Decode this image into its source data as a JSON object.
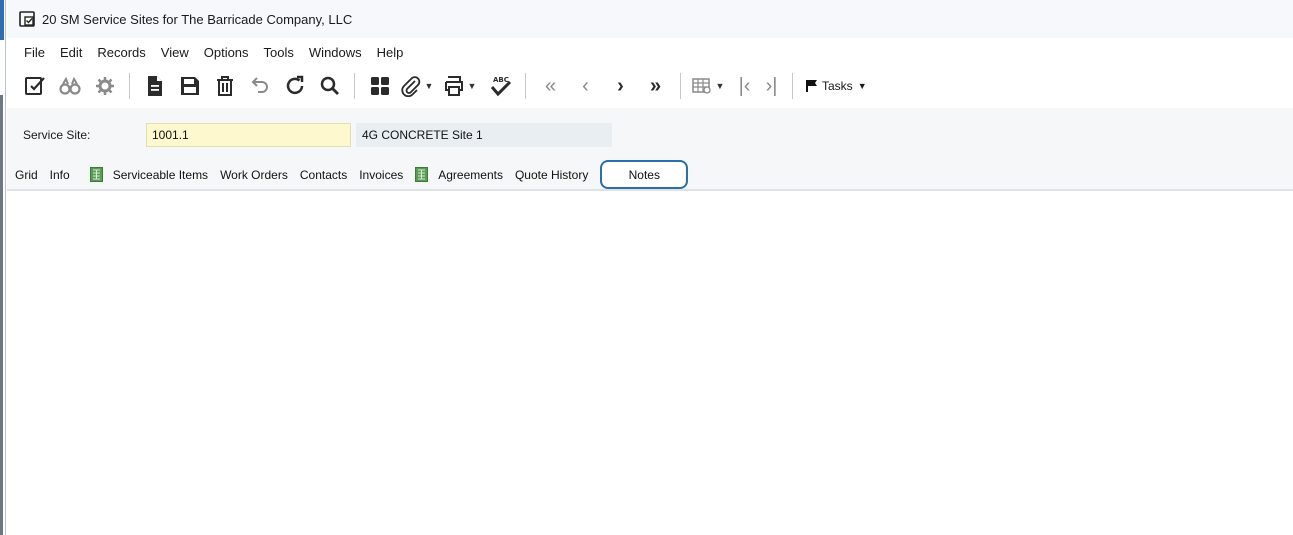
{
  "window": {
    "title": "20 SM Service Sites for The Barricade Company, LLC"
  },
  "menu": [
    {
      "label": "File"
    },
    {
      "label": "Edit"
    },
    {
      "label": "Records"
    },
    {
      "label": "View"
    },
    {
      "label": "Options"
    },
    {
      "label": "Tools"
    },
    {
      "label": "Windows"
    },
    {
      "label": "Help"
    }
  ],
  "toolbar": {
    "icons": [
      "edit-record-icon",
      "find-binoculars-icon",
      "settings-gear-icon",
      "new-document-icon",
      "save-icon",
      "delete-trash-icon",
      "undo-icon",
      "refresh-icon",
      "search-icon",
      "grid-layout-icon",
      "attachment-clip-icon",
      "print-icon",
      "spellcheck-icon",
      "first-record-icon",
      "previous-record-icon",
      "next-record-icon",
      "last-record-icon",
      "grid-options-icon",
      "first-column-icon",
      "last-column-icon",
      "flag-icon"
    ],
    "tasks_label": "Tasks"
  },
  "form": {
    "service_site_label": "Service Site:",
    "service_site_value": "1001.1",
    "service_site_description": "4G CONCRETE Site 1"
  },
  "tabs": [
    {
      "label": "Grid"
    },
    {
      "label": "Info"
    },
    {
      "label": "Serviceable Items"
    },
    {
      "label": "Work Orders"
    },
    {
      "label": "Contacts"
    },
    {
      "label": "Invoices"
    },
    {
      "label": "Agreements"
    },
    {
      "label": "Quote History"
    },
    {
      "label": "Notes"
    }
  ],
  "colors": {
    "input_highlight": "#fdf8cd",
    "focus_ring": "#2d6ea8",
    "description_field": "#e9eef2"
  }
}
